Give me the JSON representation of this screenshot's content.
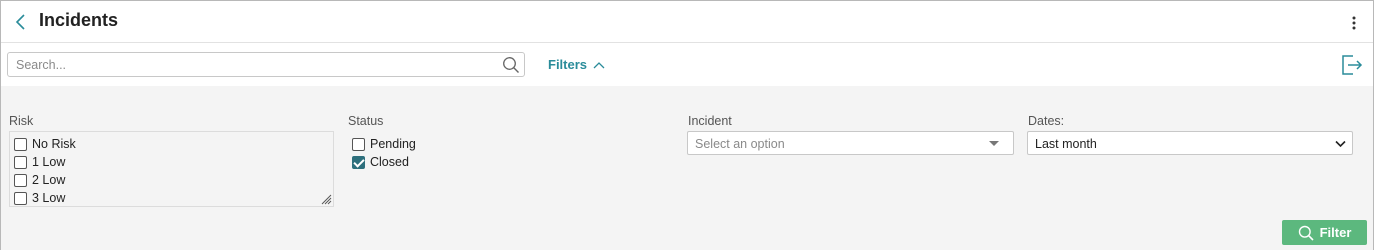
{
  "header": {
    "title": "Incidents",
    "back_icon": "chevron-left-icon",
    "more_icon": "more-vertical-icon"
  },
  "toolbar": {
    "search_placeholder": "Search...",
    "filters_label": "Filters",
    "export_icon": "logout-icon"
  },
  "filters": {
    "risk": {
      "label": "Risk",
      "options": [
        {
          "label": "No Risk",
          "checked": false
        },
        {
          "label": "1 Low",
          "checked": false
        },
        {
          "label": "2 Low",
          "checked": false
        },
        {
          "label": "3 Low",
          "checked": false
        }
      ]
    },
    "status": {
      "label": "Status",
      "options": [
        {
          "label": "Pending",
          "checked": false
        },
        {
          "label": "Closed",
          "checked": true
        }
      ]
    },
    "incident": {
      "label": "Incident",
      "placeholder": "Select an option"
    },
    "dates": {
      "label": "Dates:",
      "value": "Last month"
    },
    "filter_button": "Filter"
  },
  "colors": {
    "accent": "#2a8c9a",
    "checkbox_checked": "#2d6f7c",
    "filter_button": "#5cb87e",
    "panel_bg": "#f4f4f4"
  }
}
